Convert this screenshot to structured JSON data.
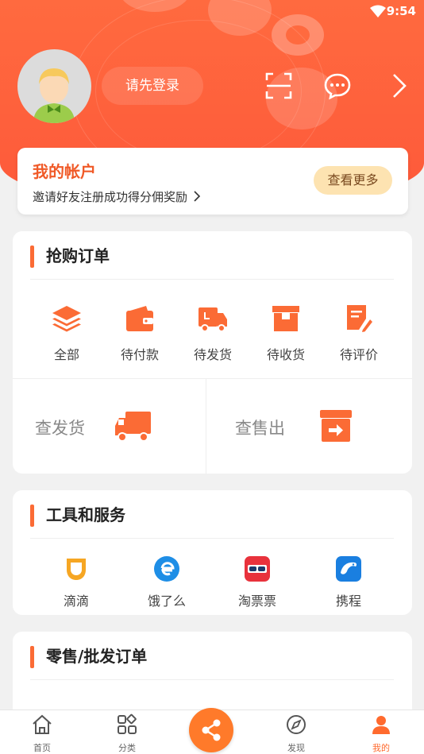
{
  "status_bar": {
    "time": "9:54"
  },
  "header": {
    "login_label": "请先登录"
  },
  "account": {
    "title": "我的帐户",
    "subtitle": "邀请好友注册成功得分佣奖励",
    "more_label": "查看更多"
  },
  "flash_orders": {
    "title": "抢购订单",
    "items": [
      {
        "label": "全部",
        "icon": "layers-icon"
      },
      {
        "label": "待付款",
        "icon": "wallet-icon"
      },
      {
        "label": "待发货",
        "icon": "truck-icon"
      },
      {
        "label": "待收货",
        "icon": "box-icon"
      },
      {
        "label": "待评价",
        "icon": "review-icon"
      }
    ],
    "check_shipping": "查发货",
    "check_sold": "查售出"
  },
  "tools": {
    "title": "工具和服务",
    "items": [
      {
        "label": "滴滴",
        "icon": "didi-icon"
      },
      {
        "label": "饿了么",
        "icon": "eleme-icon"
      },
      {
        "label": "淘票票",
        "icon": "taopiaopiao-icon"
      },
      {
        "label": "携程",
        "icon": "ctrip-icon"
      }
    ]
  },
  "retail_orders": {
    "title": "零售/批发订单"
  },
  "tabbar": {
    "items": [
      {
        "label": "首页",
        "icon": "home-icon"
      },
      {
        "label": "分类",
        "icon": "category-icon"
      },
      {
        "label": "发现",
        "icon": "compass-icon"
      },
      {
        "label": "我的",
        "icon": "user-icon"
      }
    ]
  },
  "colors": {
    "accent": "#ff6a3f",
    "icon_orange": "#fb6b35",
    "active_tab": "#ff6a2e"
  }
}
